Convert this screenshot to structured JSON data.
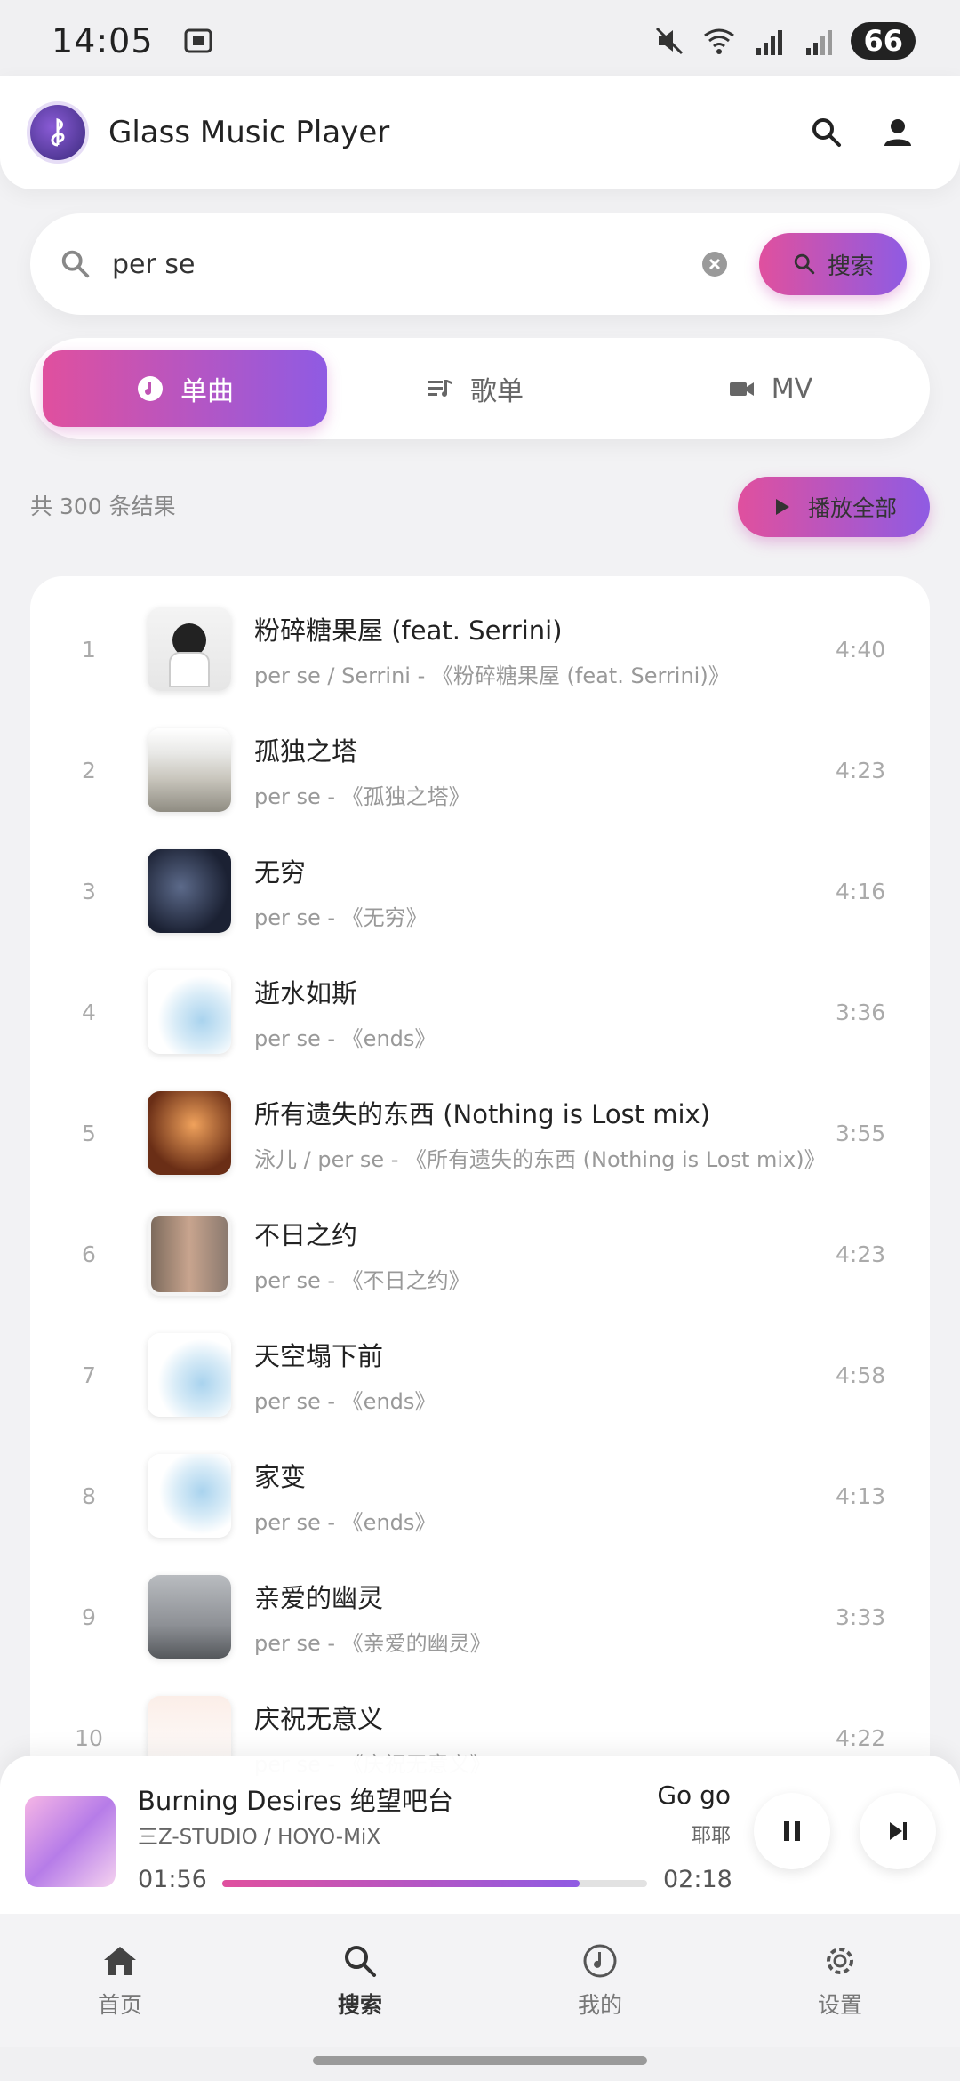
{
  "status_bar": {
    "time": "14:05",
    "battery": "66"
  },
  "app": {
    "title": "Glass Music Player"
  },
  "search": {
    "query": "per se",
    "button_label": "搜索"
  },
  "tabs": [
    {
      "label": "单曲",
      "icon": "music-note-icon",
      "active": true
    },
    {
      "label": "歌单",
      "icon": "playlist-icon",
      "active": false
    },
    {
      "label": "MV",
      "icon": "video-camera-icon",
      "active": false
    }
  ],
  "results": {
    "count_text": "共 300 条结果",
    "play_all_label": "播放全部"
  },
  "songs": [
    {
      "index": "1",
      "title": "粉碎糖果屋 (feat. Serrini)",
      "subtitle": "per se / Serrini - 《粉碎糖果屋 (feat. Serrini)》",
      "duration": "4:40"
    },
    {
      "index": "2",
      "title": "孤独之塔",
      "subtitle": "per se - 《孤独之塔》",
      "duration": "4:23"
    },
    {
      "index": "3",
      "title": "无穷",
      "subtitle": "per se - 《无穷》",
      "duration": "4:16"
    },
    {
      "index": "4",
      "title": "逝水如斯",
      "subtitle": "per se - 《ends》",
      "duration": "3:36"
    },
    {
      "index": "5",
      "title": "所有遗失的东西 (Nothing is Lost mix)",
      "subtitle": "泳儿 / per se - 《所有遗失的东西 (Nothing is Lost mix)》",
      "duration": "3:55"
    },
    {
      "index": "6",
      "title": "不日之约",
      "subtitle": "per se - 《不日之约》",
      "duration": "4:23"
    },
    {
      "index": "7",
      "title": "天空塌下前",
      "subtitle": "per se - 《ends》",
      "duration": "4:58"
    },
    {
      "index": "8",
      "title": "家变",
      "subtitle": "per se - 《ends》",
      "duration": "4:13"
    },
    {
      "index": "9",
      "title": "亲爱的幽灵",
      "subtitle": "per se - 《亲爱的幽灵》",
      "duration": "3:33"
    },
    {
      "index": "10",
      "title": "庆祝无意义",
      "subtitle": "per se - 《庆祝无意义》",
      "duration": "4:22"
    }
  ],
  "player": {
    "title": "Burning Desires 绝望吧台",
    "artist": "三Z-STUDIO / HOYO-MiX",
    "lyric_line": "Go go",
    "lyric_sub": "耶耶",
    "current_time": "01:56",
    "total_time": "02:18",
    "progress": 0.84
  },
  "nav": [
    {
      "label": "首页",
      "icon": "home-icon"
    },
    {
      "label": "搜索",
      "icon": "search-icon",
      "active": true
    },
    {
      "label": "我的",
      "icon": "music-disc-icon"
    },
    {
      "label": "设置",
      "icon": "gear-icon"
    }
  ]
}
